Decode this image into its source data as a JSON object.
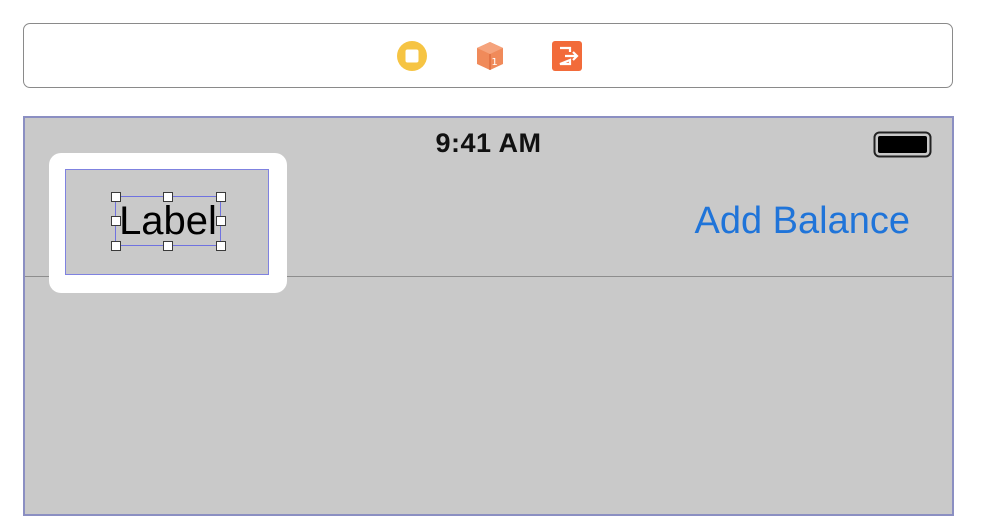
{
  "scene_dock": {
    "icons": [
      "view-controller-icon",
      "first-responder-icon",
      "exit-icon"
    ],
    "first_responder_badge": "1",
    "colors": {
      "view_controller": "#f6c443",
      "first_responder": "#f08a5a",
      "exit": "#f26b3a"
    }
  },
  "status_bar": {
    "time": "9:41 AM"
  },
  "navigation_bar": {
    "left_item_label": "Label",
    "right_item_label": "Add Balance",
    "tint_color": "#1f74d9"
  },
  "canvas": {
    "background": "#c9c9c9",
    "selection_color": "#6f72e0"
  }
}
